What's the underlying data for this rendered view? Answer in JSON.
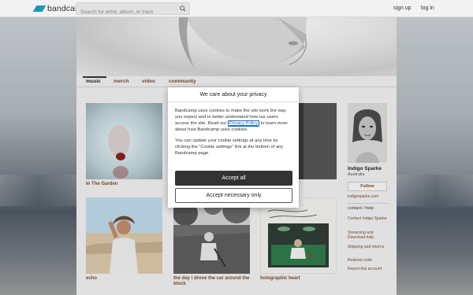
{
  "topbar": {
    "logo_text": "bandcamp",
    "search_placeholder": "Search for artist, album, or track",
    "signup": "sign up",
    "login": "log in"
  },
  "nav": {
    "tabs": [
      "music",
      "merch",
      "video",
      "community"
    ],
    "active_tab": "music"
  },
  "albums": [
    {
      "title": "In The Garden"
    },
    {
      "title": "echo"
    },
    {
      "title": "the day i drove the car around the block"
    },
    {
      "title": "holographic heart"
    }
  ],
  "sidebar": {
    "artist_name": "Indigo Sparke",
    "location": "Australia",
    "follow_label": "Follow",
    "website": "indigosparke.com",
    "contact_heading": "contact / help",
    "links": [
      "Contact Indigo Sparke",
      "Streaming and Download help",
      "Shipping and returns",
      "Redeem code",
      "Report this account"
    ]
  },
  "modal": {
    "title": "We care about your privacy",
    "para1_before": "Bandcamp uses cookies to make the site work the way you expect and to better understand how our users access the site. Read our ",
    "privacy_link": "Privacy Policy",
    "para1_after": " to learn more about how Bandcamp uses cookies.",
    "para2": "You can update your cookie settings at any time by clicking the \"Cookie settings\" link at the bottom of any Bandcamp page.",
    "accept_all": "Accept all",
    "accept_necessary": "Accept necessary only"
  },
  "colors": {
    "brand": "#1da0c3",
    "link": "#7b4b2f",
    "button_dark": "#333333"
  }
}
